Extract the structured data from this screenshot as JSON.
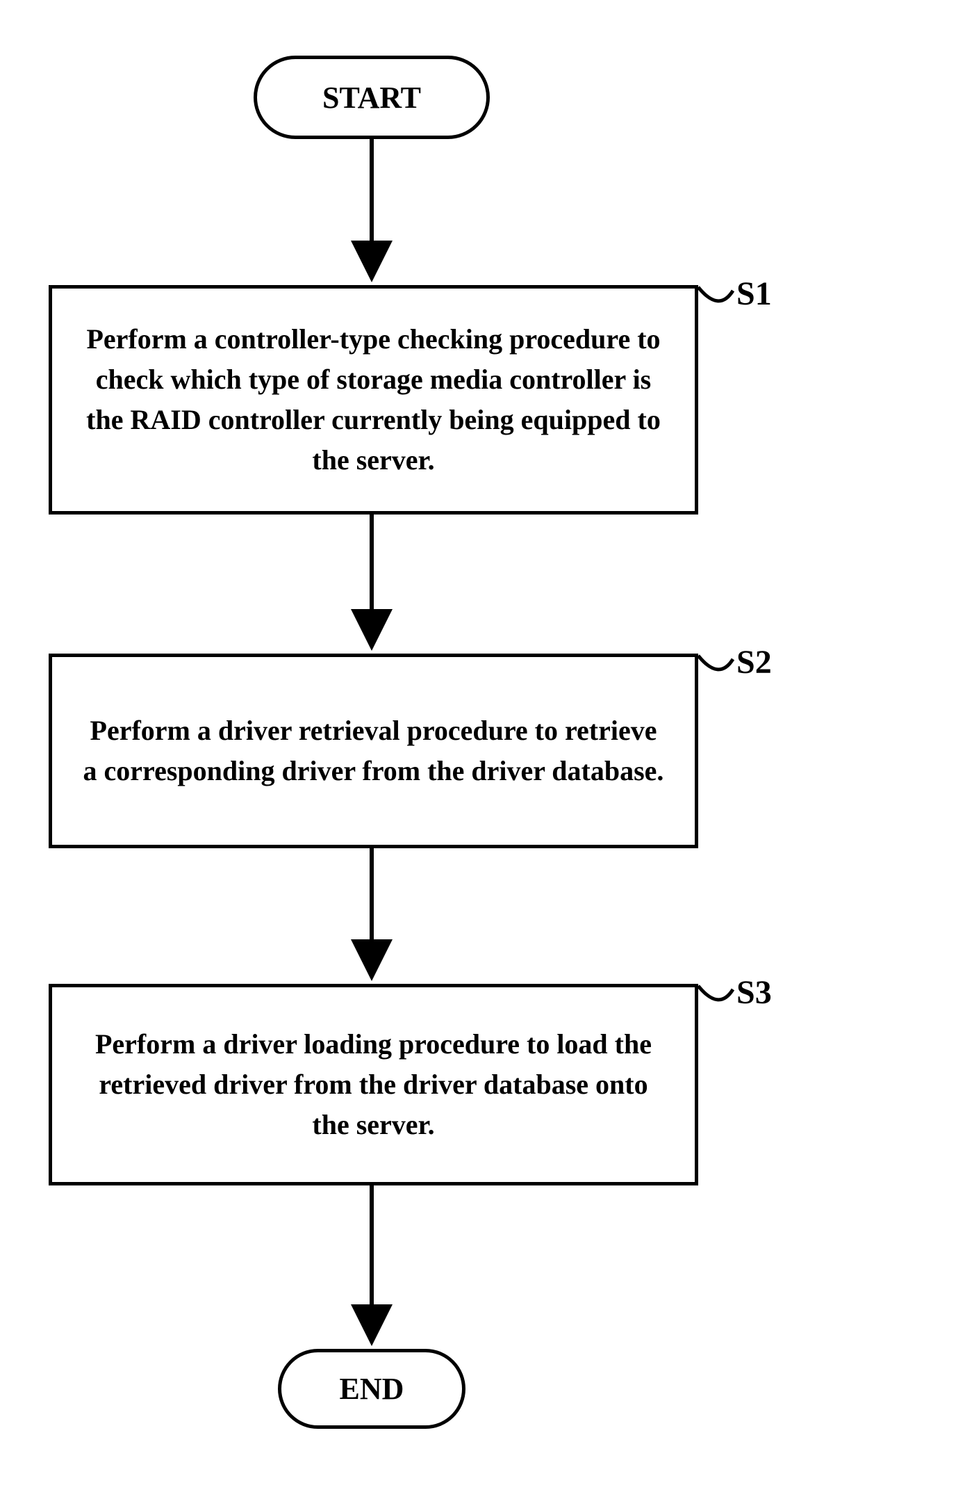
{
  "chart_data": {
    "type": "flowchart",
    "title": "",
    "nodes": [
      {
        "id": "start",
        "shape": "terminal",
        "text": "START"
      },
      {
        "id": "s1",
        "shape": "process",
        "label": "S1",
        "text": "Perform a controller-type checking procedure to check which type of storage media controller is the RAID controller currently being equipped to the server."
      },
      {
        "id": "s2",
        "shape": "process",
        "label": "S2",
        "text": "Perform a driver retrieval procedure to retrieve a corresponding driver from the driver database."
      },
      {
        "id": "s3",
        "shape": "process",
        "label": "S3",
        "text": "Perform a driver loading procedure to load the retrieved driver from the driver database onto the server."
      },
      {
        "id": "end",
        "shape": "terminal",
        "text": "END"
      }
    ],
    "edges": [
      {
        "from": "start",
        "to": "s1"
      },
      {
        "from": "s1",
        "to": "s2"
      },
      {
        "from": "s2",
        "to": "s3"
      },
      {
        "from": "s3",
        "to": "end"
      }
    ]
  },
  "start": {
    "text": "START"
  },
  "end": {
    "text": "END"
  },
  "steps": {
    "s1": {
      "label": "S1",
      "text": "Perform a controller-type checking procedure to check which type of storage media controller is the RAID controller currently being equipped to the server."
    },
    "s2": {
      "label": "S2",
      "text": "Perform a driver retrieval procedure to retrieve a corresponding driver from the driver database."
    },
    "s3": {
      "label": "S3",
      "text": "Perform a driver loading procedure to load the retrieved driver from the driver database onto the server."
    }
  }
}
